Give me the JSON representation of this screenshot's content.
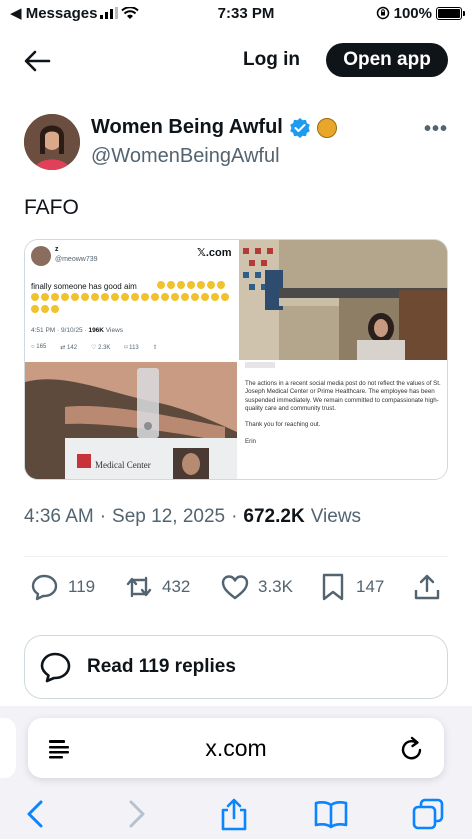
{
  "status_bar": {
    "back_app": "◀ Messages",
    "time": "7:33 PM",
    "battery": "100%"
  },
  "nav": {
    "login": "Log in",
    "open_app": "Open app"
  },
  "author": {
    "display_name": "Women Being Awful",
    "handle": "@WomenBeingAwful"
  },
  "tweet": {
    "text": "FAFO",
    "time": "4:36 AM",
    "date": "Sep 12, 2025",
    "views_count": "672.2K",
    "views_label": "Views",
    "replies": "119",
    "reposts": "432",
    "likes": "3.3K",
    "bookmarks": "147",
    "read_replies": "Read 119 replies"
  },
  "media": {
    "embedded": {
      "name": "z",
      "handle": "@meoww739",
      "x_label": "𝕏.com",
      "text": "finally someone has good aim",
      "meta_time": "4:51 PM · 9/10/25 · ",
      "meta_views": "196K",
      "meta_views_label": " Views",
      "replies": "165",
      "reposts": "142",
      "likes": "2.3K",
      "bookmarks": "113"
    },
    "badge_text": "Medical Center",
    "statement": {
      "body": "The actions in a recent social media post do not reflect the values of St. Joseph Medical Center or Prime Healthcare. The employee has been suspended immediately. We remain committed to compassionate high-quality care and community trust.",
      "thanks": "Thank you for reaching out.",
      "sign": "Erin"
    }
  },
  "browser": {
    "url": "x.com"
  },
  "colors": {
    "text": "#0f1419",
    "muted": "#536471",
    "verified": "#1d9bf0",
    "ios_blue": "#0a84ff"
  }
}
